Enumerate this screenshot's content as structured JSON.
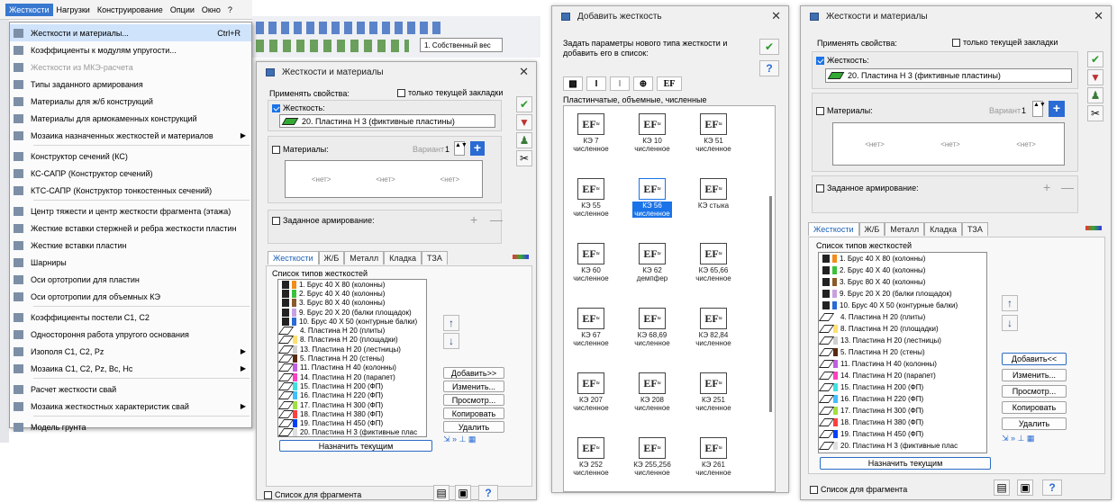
{
  "menubar": {
    "items": [
      "Жесткости",
      "Нагрузки",
      "Конструирование",
      "Опции",
      "Окно",
      "?"
    ]
  },
  "toolbar": {
    "load_case": "1. Собственный вес"
  },
  "menu": {
    "items": [
      {
        "label": "Жесткости и материалы...",
        "shortcut": "Ctrl+R"
      },
      {
        "label": "Коэффициенты к модулям упругости..."
      },
      {
        "label": "Жесткости из МКЭ-расчета"
      },
      {
        "label": "Типы заданного армирования"
      },
      {
        "label": "Материалы для ж/б конструкций"
      },
      {
        "label": "Материалы для армокаменных конструкций"
      },
      {
        "label": "Мозаика назначенных жесткостей и материалов"
      },
      {
        "label": "Конструктор сечений (КС)"
      },
      {
        "label": "КС-САПР (Конструктор сечений)"
      },
      {
        "label": "КТС-САПР (Конструктор тонкостенных сечений)"
      },
      {
        "label": "Центр тяжести и центр жесткости фрагмента (этажа)"
      },
      {
        "label": "Жесткие вставки стержней и ребра жесткости пластин"
      },
      {
        "label": "Жесткие вставки пластин"
      },
      {
        "label": "Шарниры"
      },
      {
        "label": "Оси ортотропии для пластин"
      },
      {
        "label": "Оси ортотропии для объемных КЭ"
      },
      {
        "label": "Коэффициенты постели С1, С2"
      },
      {
        "label": "Одностороння работа упругого основания"
      },
      {
        "label": "Изополя С1, С2, Pz"
      },
      {
        "label": "Мозаика С1, С2, Pz, Bc, Hc"
      },
      {
        "label": "Расчет жесткости свай"
      },
      {
        "label": "Мозаика жесткостных характеристик свай"
      },
      {
        "label": "Модель грунта"
      }
    ]
  },
  "dialog": {
    "title": "Жесткости и материалы",
    "apply_props": "Применять свойства:",
    "current_tab_only": "только текущей закладки",
    "stiffness_label": "Жесткость:",
    "stiffness_value": "20. Пластина  Н 3 (фиктивные пластины)",
    "materials_label": "Материалы:",
    "variant_label": "Вариант",
    "variant_value": "1",
    "none": "<нет>",
    "reinforcement_label": "Заданное армирование:",
    "tabs": [
      "Жесткости",
      "Ж/Б",
      "Металл",
      "Кладка",
      "ТЗА"
    ],
    "list_title": "Список типов жесткостей",
    "list": [
      "1. Брус 40 X 80 (колонны)",
      "2. Брус 40 X 40 (колонны)",
      "3. Брус 80 X 40 (колонны)",
      "9. Брус 20 X 20 (балки площадок)",
      "10. Брус 40 X 50 (контурные балки)",
      "4. Пластина  Н 20 (плиты)",
      "8. Пластина  Н 20 (площадки)",
      "13. Пластина  Н 20 (лестницы)",
      "5. Пластина  Н 20 (стены)",
      "11. Пластина  Н 40 (колонны)",
      "14. Пластина  Н 20 (парапет)",
      "15. Пластина  Н 200 (ФП)",
      "16. Пластина  Н 220 (ФП)",
      "17. Пластина  Н 300 (ФП)",
      "18. Пластина  Н 380 (ФП)",
      "19. Пластина  Н 450 (ФП)",
      "20. Пластина  Н 3 (фиктивные плас"
    ],
    "swatch_colors": [
      "#f28c1a",
      "#3cc13c",
      "#8a5a2a",
      "#c8a0e0",
      "#2a6bd4",
      "#ffffff",
      "#ffe070",
      "#d0d0d0",
      "#5a2a10",
      "#c060e0",
      "#ff40c0",
      "#40e0e0",
      "#40c0ff",
      "#a0e040",
      "#ff4040",
      "#0040ff",
      "#e0e0e0"
    ],
    "add_btn": "Добавить>>",
    "add_btn_back": "Добавить<<",
    "edit_btn": "Изменить...",
    "view_btn": "Просмотр...",
    "copy_btn": "Копировать",
    "delete_btn": "Удалить",
    "assign_btn": "Назначить текущим",
    "fragment_list": "Список для фрагмента"
  },
  "add_dialog": {
    "title": "Добавить жесткость",
    "prompt": "Задать параметры нового типа жесткости и добавить его в список:",
    "category": "Пластинчатые, объемные, численные",
    "tiles": [
      {
        "top": "КЭ 7",
        "bot": "численное"
      },
      {
        "top": "КЭ 10",
        "bot": "численное"
      },
      {
        "top": "КЭ 51",
        "bot": "численное"
      },
      {
        "top": "КЭ 55",
        "bot": "численное"
      },
      {
        "top": "КЭ 56",
        "bot": "численное"
      },
      {
        "top": "КЭ стыка",
        "bot": ""
      },
      {
        "top": "КЭ 60",
        "bot": "численное"
      },
      {
        "top": "КЭ 62",
        "bot": "демпфер"
      },
      {
        "top": "КЭ 65,66",
        "bot": "численное"
      },
      {
        "top": "КЭ 67",
        "bot": "численное"
      },
      {
        "top": "КЭ 68,69",
        "bot": "численное"
      },
      {
        "top": "КЭ 82,84",
        "bot": "численное"
      },
      {
        "top": "КЭ 207",
        "bot": "численное"
      },
      {
        "top": "КЭ 208",
        "bot": "численное"
      },
      {
        "top": "КЭ 251",
        "bot": "численное"
      },
      {
        "top": "КЭ 252",
        "bot": "численное"
      },
      {
        "top": "КЭ 255,256",
        "bot": "численное"
      },
      {
        "top": "КЭ 261",
        "bot": "численное"
      }
    ],
    "tile_glyph": "EF",
    "tile_sub": "≈"
  }
}
